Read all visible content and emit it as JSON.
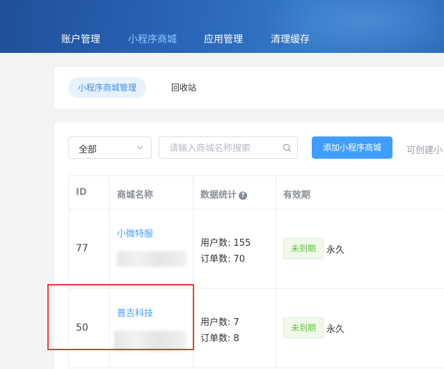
{
  "nav": {
    "items": [
      {
        "label": "账户管理",
        "active": false
      },
      {
        "label": "小程序商城",
        "active": true
      },
      {
        "label": "应用管理",
        "active": false
      },
      {
        "label": "清理缓存",
        "active": false
      }
    ]
  },
  "tabs": {
    "active": "小程序商城管理",
    "recycle": "回收站"
  },
  "filter": {
    "select_value": "全部",
    "search_placeholder": "请输入商城名称搜索",
    "add_button": "添加小程序商城",
    "hint": "可创建小"
  },
  "table": {
    "headers": {
      "id": "ID",
      "name": "商城名称",
      "stats": "数据统计",
      "validity": "有效期"
    },
    "rows": [
      {
        "id": "77",
        "name": "小微特服",
        "users": "用户数: 155",
        "orders": "订单数: 70",
        "status": "未到期",
        "period": "永久"
      },
      {
        "id": "50",
        "name": "普吉科技",
        "users": "用户数: 7",
        "orders": "订单数: 8",
        "status": "未到期",
        "period": "永久"
      }
    ]
  },
  "colors": {
    "accent": "#409eff",
    "active_nav": "#8cc9ff",
    "tag_green": "#67c23a",
    "highlight_box": "#e53935"
  }
}
